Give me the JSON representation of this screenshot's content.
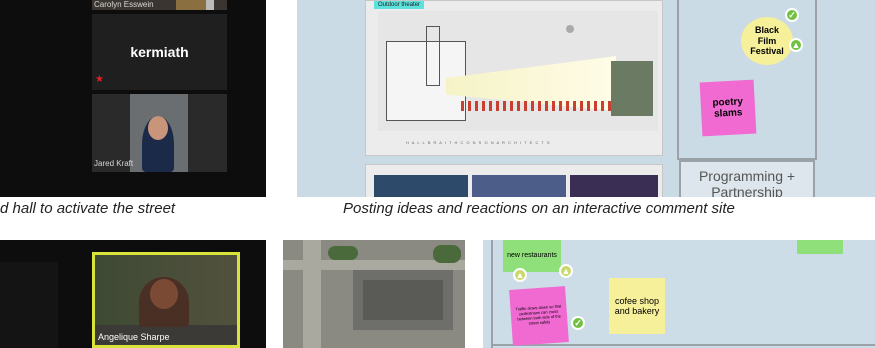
{
  "top_left": {
    "participant_1": "Carolyn Esswein",
    "participant_2": "kermiath",
    "participant_3": "Jared Kraft"
  },
  "captions": {
    "left": "d hall to activate the street",
    "right": "Posting ideas and reactions on an interactive comment site"
  },
  "top_right": {
    "image_tag": "Outdoor theater",
    "architects_line": "H A L L B R A I T H    C O N S O N    A R C H I T E C T S",
    "sticky_festival": "Black Film Festival",
    "sticky_poetry": "poetry slams",
    "section_label": "Programming + Partnership"
  },
  "bottom_left": {
    "participant_4": "Angelique Sharpe"
  },
  "bottom_right": {
    "sticky_restaurants": "new restaurants",
    "sticky_traffic": "Traffic slows down so that pedestrians can cross between both side of the street safely",
    "sticky_cofee": "cofee shop and bakery"
  },
  "colors": {
    "board_bg": "#cbdbe6",
    "sticky_yellow": "#f6f09a",
    "sticky_pink": "#f06ad2",
    "sticky_green": "#8fe07a",
    "check_green": "#6fc13f"
  }
}
